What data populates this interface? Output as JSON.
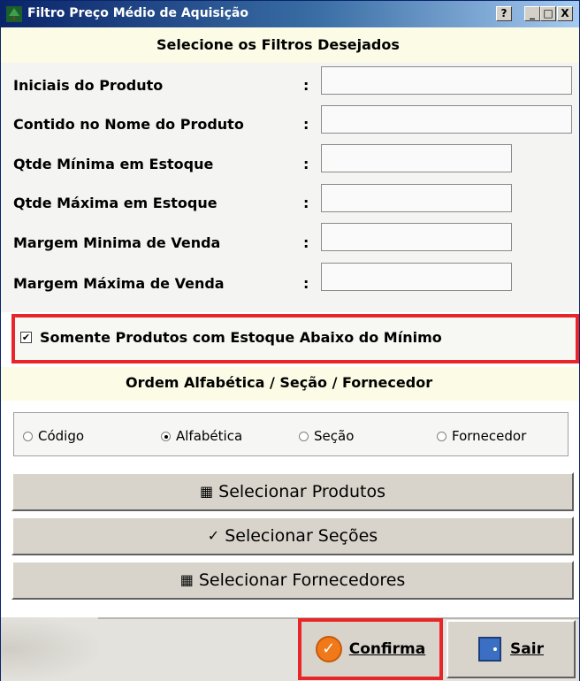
{
  "window": {
    "title": "Filtro Preço Médio de Aquisição",
    "controls": {
      "help": "?",
      "minimize": "_",
      "maximize": "□",
      "close": "X"
    }
  },
  "header": {
    "title": "Selecione os Filtros Desejados"
  },
  "filters": {
    "separator": ":",
    "fields": [
      {
        "label": "Iniciais do Produto",
        "value": ""
      },
      {
        "label": "Contido no Nome do Produto",
        "value": ""
      },
      {
        "label": "Qtde Mínima em Estoque",
        "value": ""
      },
      {
        "label": "Qtde Máxima em Estoque",
        "value": ""
      },
      {
        "label": "Margem Minima de Venda",
        "value": ""
      },
      {
        "label": "Margem Máxima de Venda",
        "value": ""
      }
    ]
  },
  "stock_below_min": {
    "label": "Somente Produtos com Estoque Abaixo do Mínimo",
    "checked": true,
    "mark": "✔"
  },
  "order": {
    "title": "Ordem Alfabética / Seção / Fornecedor",
    "options": [
      {
        "label": "Código",
        "selected": false
      },
      {
        "label": "Alfabética",
        "selected": true
      },
      {
        "label": "Seção",
        "selected": false
      },
      {
        "label": "Fornecedor",
        "selected": false
      }
    ]
  },
  "actions": {
    "select_products": "Selecionar Produtos",
    "select_sections": "Selecionar Seções",
    "select_suppliers": "Selecionar Fornecedores"
  },
  "footer": {
    "confirm": "Confirma",
    "exit": "Sair"
  },
  "colors": {
    "highlight": "#e8262a",
    "title_bar": "#0a246a",
    "panel_cream": "#fbfbe6",
    "button_face": "#d8d4cc"
  }
}
